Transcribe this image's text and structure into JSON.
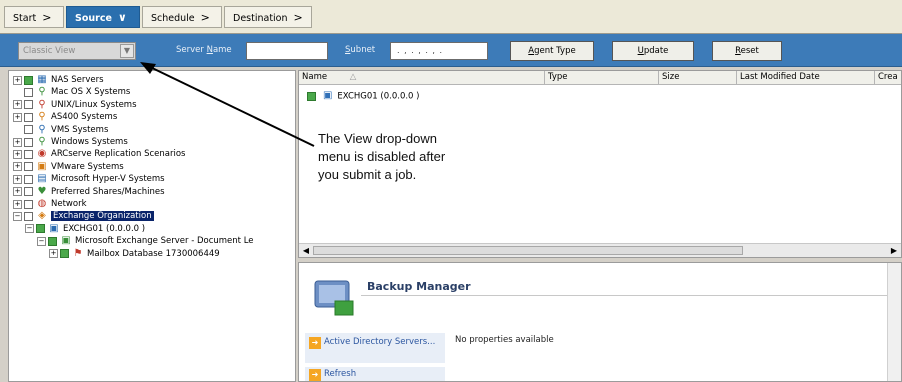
{
  "tabs": [
    {
      "label": "Start",
      "arrow": ">"
    },
    {
      "label": "Source",
      "arrow": "∨"
    },
    {
      "label": "Schedule",
      "arrow": ">"
    },
    {
      "label": "Destination",
      "arrow": ">"
    }
  ],
  "toolbar": {
    "view_select": "Classic View",
    "server_name_label_prefix": "Server ",
    "server_name_label_underlined": "N",
    "server_name_label_suffix": "ame",
    "server_name_value": "",
    "subnet_label_underlined": "S",
    "subnet_label_suffix": "ubnet",
    "subnet_value": ". , . , . , .",
    "agent_type_underlined": "A",
    "agent_type_suffix": "gent Type",
    "update_underlined": "U",
    "update_suffix": "pdate",
    "reset_underlined": "R",
    "reset_suffix": "eset"
  },
  "tree": [
    {
      "label": "NAS Servers",
      "icon": "▦",
      "indent": 0,
      "expander": "+"
    },
    {
      "label": "Mac OS X Systems",
      "icon": "⚲",
      "indent": 0,
      "expander": ""
    },
    {
      "label": "UNIX/Linux Systems",
      "icon": "⚲",
      "indent": 0,
      "expander": "+"
    },
    {
      "label": "AS400 Systems",
      "icon": "⚲",
      "indent": 0,
      "expander": "+"
    },
    {
      "label": "VMS Systems",
      "icon": "⚲",
      "indent": 0,
      "expander": ""
    },
    {
      "label": "Windows Systems",
      "icon": "⚲",
      "indent": 0,
      "expander": "+"
    },
    {
      "label": "ARCserve Replication Scenarios",
      "icon": "◉",
      "indent": 0,
      "expander": "+"
    },
    {
      "label": "VMware Systems",
      "icon": "▣",
      "indent": 0,
      "expander": "+"
    },
    {
      "label": "Microsoft Hyper-V Systems",
      "icon": "▤",
      "indent": 0,
      "expander": "+"
    },
    {
      "label": "Preferred Shares/Machines",
      "icon": "♥",
      "indent": 0,
      "expander": "+"
    },
    {
      "label": "Network",
      "icon": "◍",
      "indent": 0,
      "expander": "+"
    },
    {
      "label": "Exchange Organization",
      "icon": "◈",
      "indent": 0,
      "expander": "−",
      "selected": true
    },
    {
      "label": "EXCHG01 (0.0.0.0 )",
      "icon": "▣",
      "indent": 1,
      "expander": "−"
    },
    {
      "label": "Microsoft Exchange Server - Document Le",
      "icon": "▣",
      "indent": 2,
      "expander": "−"
    },
    {
      "label": "Mailbox Database 1730006449",
      "icon": "⚑",
      "indent": 3,
      "expander": "+"
    }
  ],
  "list": {
    "columns": [
      "Name",
      "Type",
      "Size",
      "Last Modified Date",
      "Crea"
    ],
    "items": [
      "EXCHG01 (0.0.0.0 )"
    ]
  },
  "annotation": [
    "The View drop-down",
    "menu is disabled after",
    "you submit a job."
  ],
  "detail": {
    "title": "Backup Manager",
    "links": [
      "Active Directory Servers...",
      "Refresh"
    ],
    "message": "No properties available"
  }
}
